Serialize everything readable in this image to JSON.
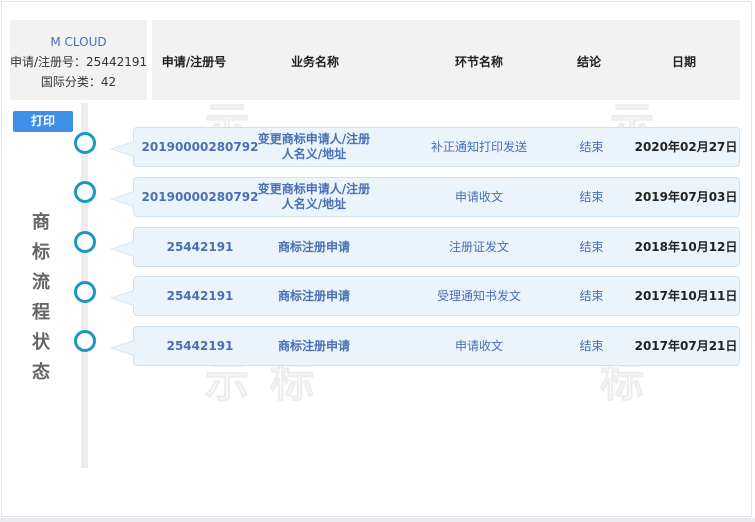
{
  "logo": {
    "brand": "M CLOUD",
    "reg_label": "申请/注册号：25442191",
    "class_label": "国际分类：42"
  },
  "header": {
    "col_number": "申请/注册号",
    "col_business": "业务名称",
    "col_step": "环节名称",
    "col_result": "结论",
    "col_date": "日期"
  },
  "print_label": "打印",
  "side_title": [
    "商",
    "标",
    "流",
    "程",
    "状",
    "态"
  ],
  "rows": [
    {
      "number": "20190000280792",
      "business": "变更商标申请人/注册人名义/地址",
      "step": "补正通知打印发送",
      "result": "结束",
      "date": "2020年02月27日"
    },
    {
      "number": "20190000280792",
      "business": "变更商标申请人/注册人名义/地址",
      "step": "申请收文",
      "result": "结束",
      "date": "2019年07月03日"
    },
    {
      "number": "25442191",
      "business": "商标注册申请",
      "step": "注册证发文",
      "result": "结束",
      "date": "2018年10月12日"
    },
    {
      "number": "25442191",
      "business": "商标注册申请",
      "step": "受理通知书发文",
      "result": "结束",
      "date": "2017年10月11日"
    },
    {
      "number": "25442191",
      "business": "商标注册申请",
      "step": "申请收文",
      "result": "结束",
      "date": "2017年07月21日"
    }
  ],
  "colors": {
    "accent": "#3f8ee8",
    "dot": "#1b96c8",
    "row_bg": "#eaf4fa",
    "link_text": "#4a6fb5"
  }
}
